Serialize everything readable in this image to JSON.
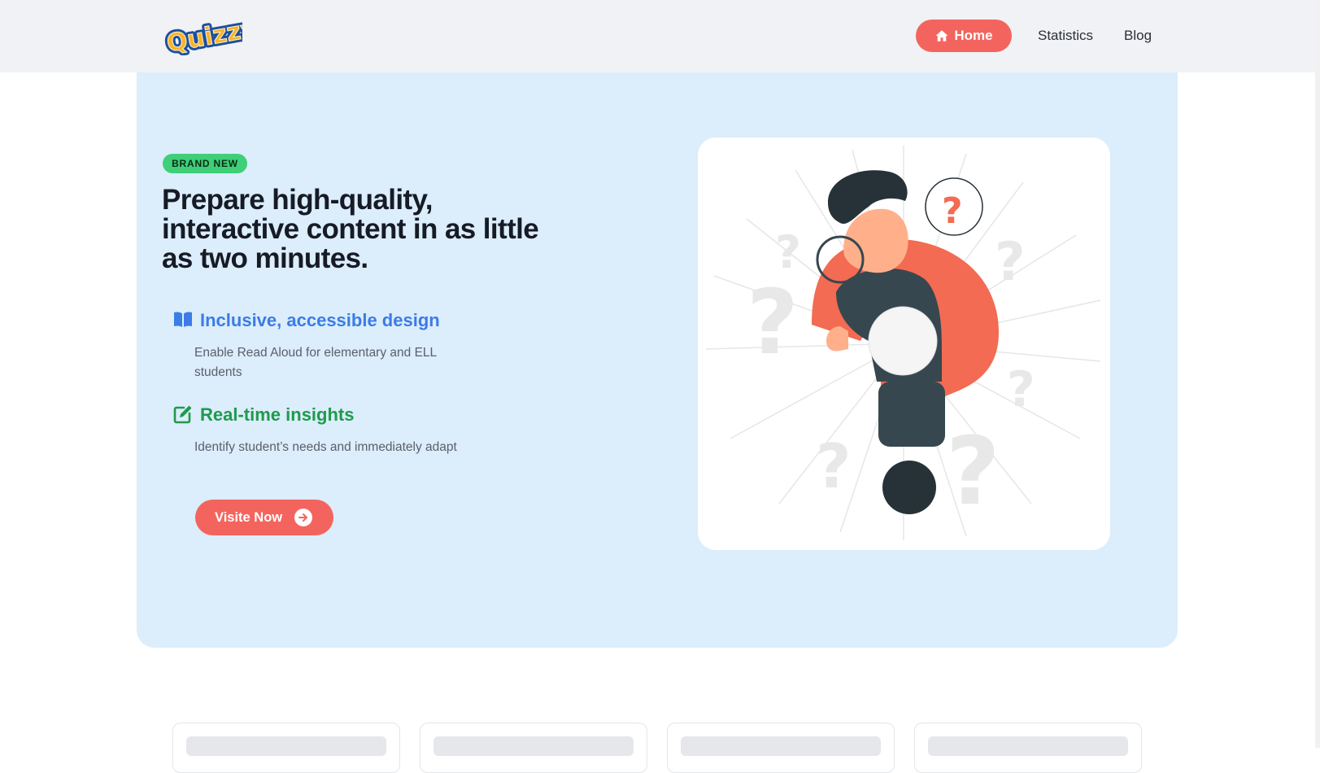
{
  "nav": {
    "logo_text": "Quizzy",
    "home_label": "Home",
    "statistics_label": "Statistics",
    "blog_label": "Blog"
  },
  "hero": {
    "badge": "BRAND NEW",
    "headline": "Prepare high-quality, interactive content in as little as two minutes.",
    "features": [
      {
        "title": "Inclusive, accessible design",
        "description": "Enable Read Aloud for elementary and ELL students",
        "icon": "book-open-icon",
        "color": "#3b7ce6"
      },
      {
        "title": "Real-time insights",
        "description": "Identify student’s needs and immediately adapt",
        "icon": "edit-icon",
        "color": "#1f9a4c"
      }
    ],
    "cta_label": "Visite Now"
  },
  "colors": {
    "accent": "#f4645e",
    "hero_bg": "#dcedfb",
    "badge_bg": "#3ecf78"
  }
}
